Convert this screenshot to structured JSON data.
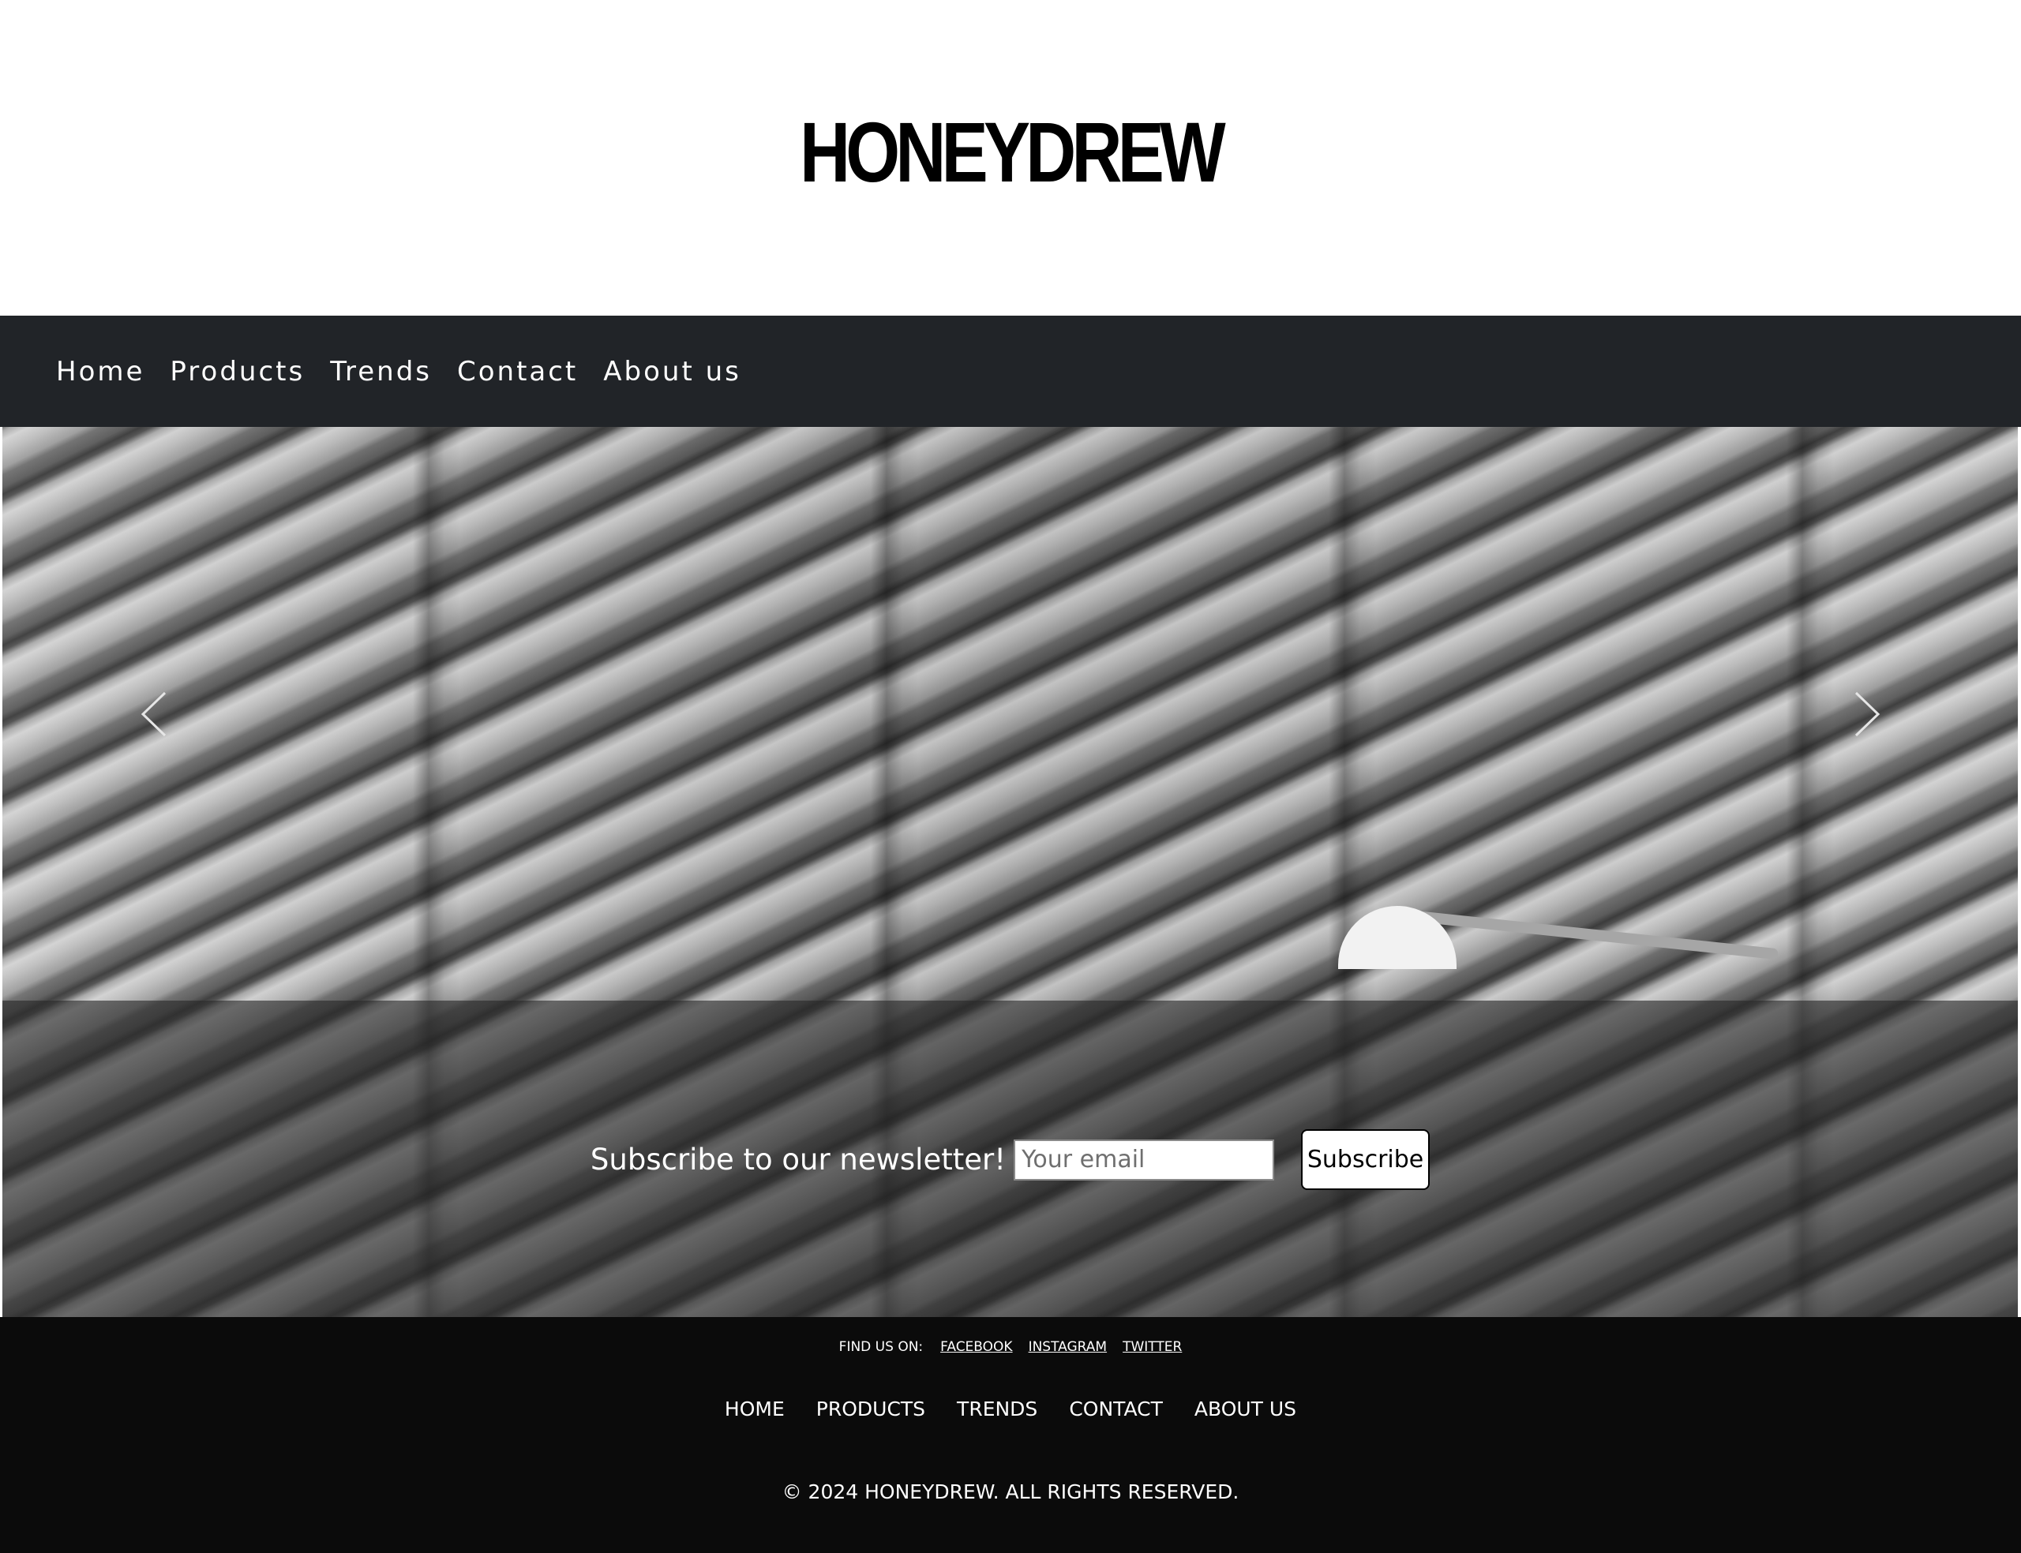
{
  "header": {
    "logo_text": "HONEYDREW"
  },
  "nav": {
    "items": [
      {
        "label": "Home"
      },
      {
        "label": "Products"
      },
      {
        "label": "Trends"
      },
      {
        "label": "Contact"
      },
      {
        "label": "About us"
      }
    ]
  },
  "hero": {
    "prev_icon": "chevron-left-icon",
    "next_icon": "chevron-right-icon"
  },
  "newsletter": {
    "label": "Subscribe to our newsletter!",
    "email_placeholder": "Your email",
    "email_value": "",
    "button_label": "Subscribe"
  },
  "footer": {
    "social_label": "FIND US ON:",
    "social_links": [
      {
        "label": "FACEBOOK"
      },
      {
        "label": "INSTAGRAM"
      },
      {
        "label": "TWITTER"
      }
    ],
    "nav_items": [
      {
        "label": "HOME"
      },
      {
        "label": "PRODUCTS"
      },
      {
        "label": "TRENDS"
      },
      {
        "label": "CONTACT"
      },
      {
        "label": "ABOUT US"
      }
    ],
    "copyright": "© 2024 HONEYDREW. ALL RIGHTS RESERVED."
  },
  "colors": {
    "navbar_bg": "#212428",
    "footer_bg": "#0b0b0b",
    "page_bg": "#ffffff"
  }
}
